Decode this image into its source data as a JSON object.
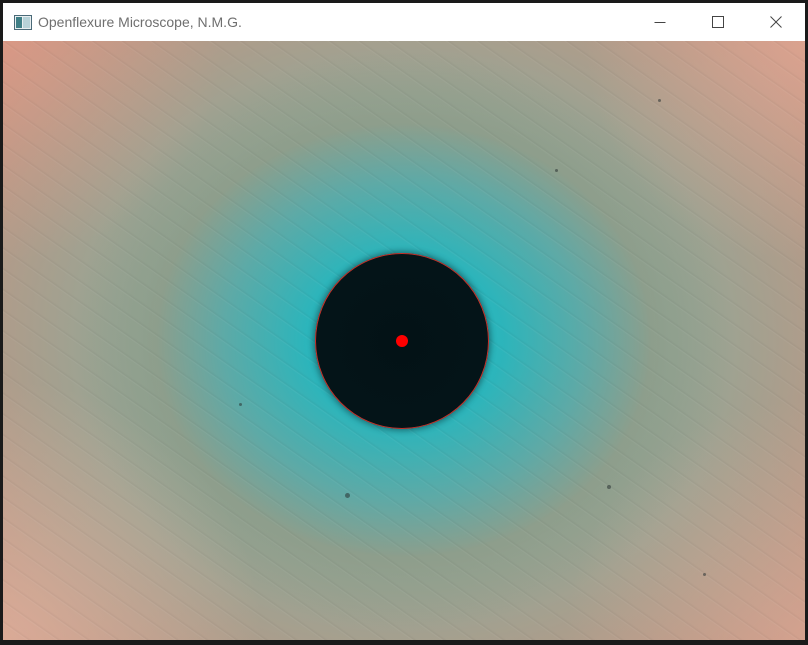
{
  "window": {
    "title": "Openflexure Microscope, N.M.G.",
    "app_icon": "image-window-icon",
    "controls": {
      "minimize": "minimize-icon",
      "maximize": "maximize-icon",
      "close": "close-icon"
    }
  },
  "viewport": {
    "content": "microscope-camera-feed",
    "overlay": {
      "detected_circle_color": "#c8322a",
      "center_marker_color": "#ff0000"
    }
  },
  "colors": {
    "titlebar_bg": "#ffffff",
    "title_text": "#6f6f6f",
    "frame_bg": "#1a1a1a"
  }
}
